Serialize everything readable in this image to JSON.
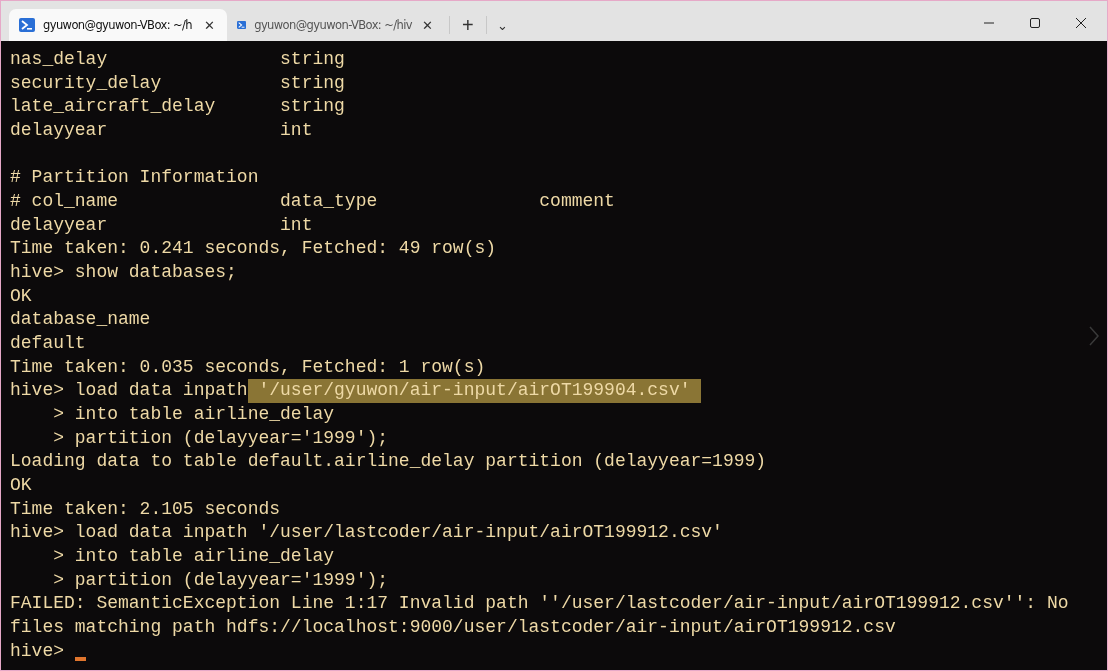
{
  "tabs": [
    {
      "title": "gyuwon@gyuwon-VBox: ~/h",
      "selected": true,
      "close": "✕"
    },
    {
      "title": "gyuwon@gyuwon-VBox: ~/hiv",
      "selected": false,
      "close": "✕"
    }
  ],
  "new_tab": "+",
  "dropdown": "⌄",
  "terminal": {
    "lines": [
      {
        "kind": "text",
        "text": "nas_delay                string"
      },
      {
        "kind": "text",
        "text": "security_delay           string"
      },
      {
        "kind": "text",
        "text": "late_aircraft_delay      string"
      },
      {
        "kind": "text",
        "text": "delayyear                int"
      },
      {
        "kind": "blank"
      },
      {
        "kind": "text",
        "text": "# Partition Information"
      },
      {
        "kind": "text",
        "text": "# col_name               data_type               comment"
      },
      {
        "kind": "text",
        "text": "delayyear                int"
      },
      {
        "kind": "text",
        "text": "Time taken: 0.241 seconds, Fetched: 49 row(s)"
      },
      {
        "kind": "text",
        "text": "hive> show databases;"
      },
      {
        "kind": "text",
        "text": "OK"
      },
      {
        "kind": "text",
        "text": "database_name"
      },
      {
        "kind": "text",
        "text": "default"
      },
      {
        "kind": "text",
        "text": "Time taken: 0.035 seconds, Fetched: 1 row(s)"
      },
      {
        "kind": "text",
        "text": "hive> load data inpath",
        "selection": " '/user/gyuwon/air-input/airOT199904.csv' "
      },
      {
        "kind": "text",
        "text": "    > into table airline_delay"
      },
      {
        "kind": "text",
        "text": "    > partition (delayyear='1999');"
      },
      {
        "kind": "text",
        "text": "Loading data to table default.airline_delay partition (delayyear=1999)"
      },
      {
        "kind": "text",
        "text": "OK"
      },
      {
        "kind": "text",
        "text": "Time taken: 2.105 seconds"
      },
      {
        "kind": "text",
        "text": "hive> load data inpath '/user/lastcoder/air-input/airOT199912.csv'"
      },
      {
        "kind": "text",
        "text": "    > into table airline_delay"
      },
      {
        "kind": "text",
        "text": "    > partition (delayyear='1999');"
      },
      {
        "kind": "text",
        "text": "FAILED: SemanticException Line 1:17 Invalid path ''/user/lastcoder/air-input/airOT199912.csv'': No"
      },
      {
        "kind": "text",
        "text": "files matching path hdfs://localhost:9000/user/lastcoder/air-input/airOT199912.csv"
      },
      {
        "kind": "prompt",
        "text": "hive>",
        "cursor": true
      }
    ]
  }
}
